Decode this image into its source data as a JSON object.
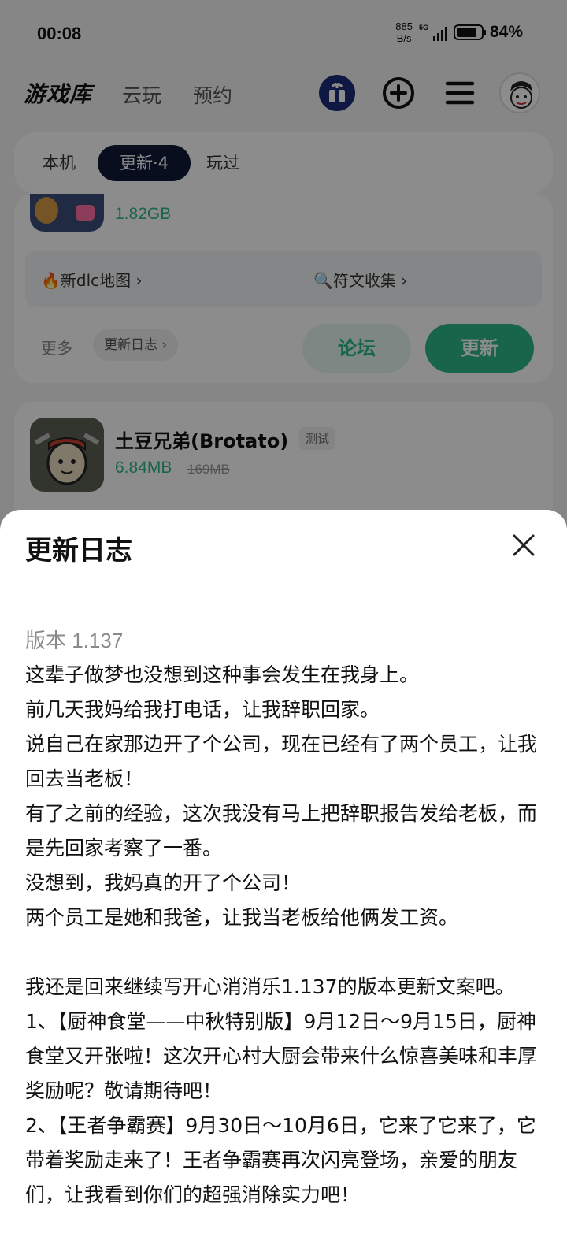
{
  "status_bar": {
    "time": "00:08",
    "net_speed_value": "885",
    "net_speed_unit": "B/s",
    "signal_tag": "5G",
    "battery": "84%"
  },
  "nav": {
    "brand": "游戏库",
    "tabs": [
      "云玩",
      "预约"
    ]
  },
  "segments": {
    "local": "本机",
    "updates": "更新·4",
    "played": "玩过"
  },
  "card1": {
    "size": "1.82GB",
    "link1": "🔥新dlc地图 ›",
    "link2": "🔍符文收集 ›",
    "more": "更多",
    "changelog_chip": "更新日志 ›",
    "forum": "论坛",
    "update": "更新"
  },
  "card2": {
    "title": "土豆兄弟(Brotato)",
    "badge": "测试",
    "size": "6.84MB",
    "old_size": "169MB"
  },
  "sheet": {
    "title": "更新日志",
    "version": "版本 1.137",
    "notes": [
      "这辈子做梦也没想到这种事会发生在我身上。",
      "前几天我妈给我打电话，让我辞职回家。",
      "说自己在家那边开了个公司，现在已经有了两个员工，让我回去当老板！",
      "有了之前的经验，这次我没有马上把辞职报告发给老板，而是先回家考察了一番。",
      "没想到，我妈真的开了个公司！",
      "两个员工是她和我爸，让我当老板给他俩发工资。",
      " ",
      "我还是回来继续写开心消消乐1.137的版本更新文案吧。",
      "1、【厨神食堂——中秋特别版】9月12日～9月15日，厨神食堂又开张啦！这次开心村大厨会带来什么惊喜美味和丰厚奖励呢？敬请期待吧！",
      "2、【王者争霸赛】9月30日～10月6日，它来了它来了，它带着奖励走来了！王者争霸赛再次闪亮登场，亲爱的朋友们，让我看到你们的超强消除实力吧！"
    ]
  }
}
